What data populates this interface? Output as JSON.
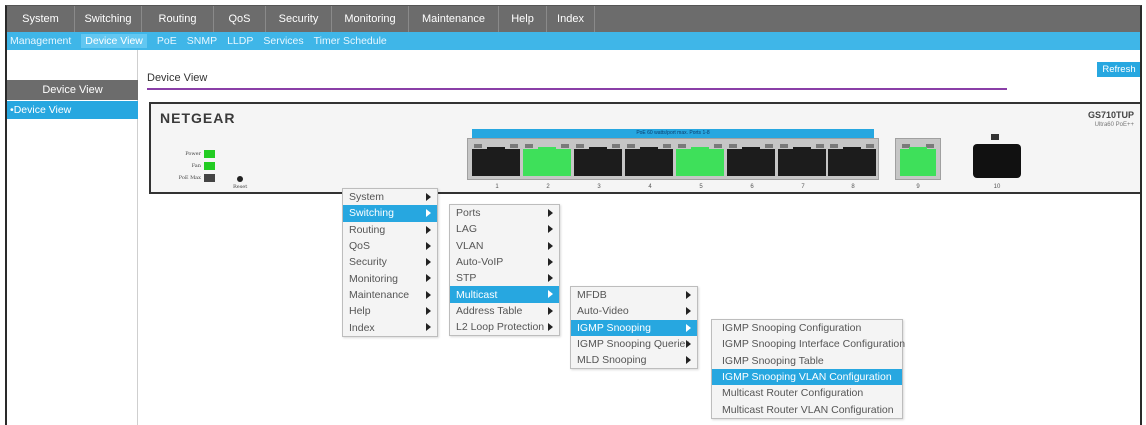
{
  "topnav": {
    "tabs": [
      {
        "label": "System",
        "active": true
      },
      {
        "label": "Switching",
        "active": false
      },
      {
        "label": "Routing",
        "active": false
      },
      {
        "label": "QoS",
        "active": false
      },
      {
        "label": "Security",
        "active": false
      },
      {
        "label": "Monitoring",
        "active": false
      },
      {
        "label": "Maintenance",
        "active": false
      },
      {
        "label": "Help",
        "active": false
      },
      {
        "label": "Index",
        "active": false
      }
    ]
  },
  "subnav": {
    "items": [
      {
        "label": "Management",
        "active": false
      },
      {
        "label": "Device View",
        "active": true
      },
      {
        "label": "PoE",
        "active": false
      },
      {
        "label": "SNMP",
        "active": false
      },
      {
        "label": "LLDP",
        "active": false
      },
      {
        "label": "Services",
        "active": false
      },
      {
        "label": "Timer Schedule",
        "active": false
      }
    ]
  },
  "left_panel": {
    "heading": "Device View",
    "items": [
      {
        "label": "Device View",
        "active": true
      }
    ]
  },
  "content": {
    "title": "Device View",
    "refresh_label": "Refresh"
  },
  "device": {
    "brand": "NETGEAR",
    "model": "GS710TUP",
    "model_sub": "Ultra60 PoE++",
    "leds": [
      {
        "label": "Power",
        "color": "#22cc22"
      },
      {
        "label": "Fan",
        "color": "#22cc22"
      },
      {
        "label": "PoE Max",
        "color": "#444444"
      }
    ],
    "reset_label": "Reset",
    "poe_banner": "PoE 60 watts/port max. Ports 1-8",
    "ports": [
      {
        "number": "1",
        "state": "inactive"
      },
      {
        "number": "2",
        "state": "active"
      },
      {
        "number": "3",
        "state": "inactive"
      },
      {
        "number": "4",
        "state": "inactive"
      },
      {
        "number": "5",
        "state": "active"
      },
      {
        "number": "6",
        "state": "inactive"
      },
      {
        "number": "7",
        "state": "inactive"
      },
      {
        "number": "8",
        "state": "inactive"
      }
    ],
    "port9": {
      "number": "9",
      "state": "active"
    },
    "port10": {
      "number": "10",
      "state": "sfp"
    }
  },
  "menus": {
    "level1": [
      {
        "label": "System",
        "selected": false
      },
      {
        "label": "Switching",
        "selected": true
      },
      {
        "label": "Routing",
        "selected": false
      },
      {
        "label": "QoS",
        "selected": false
      },
      {
        "label": "Security",
        "selected": false
      },
      {
        "label": "Monitoring",
        "selected": false
      },
      {
        "label": "Maintenance",
        "selected": false
      },
      {
        "label": "Help",
        "selected": false
      },
      {
        "label": "Index",
        "selected": false
      }
    ],
    "level2": [
      {
        "label": "Ports",
        "selected": false
      },
      {
        "label": "LAG",
        "selected": false
      },
      {
        "label": "VLAN",
        "selected": false
      },
      {
        "label": "Auto-VoIP",
        "selected": false
      },
      {
        "label": "STP",
        "selected": false
      },
      {
        "label": "Multicast",
        "selected": true
      },
      {
        "label": "Address Table",
        "selected": false
      },
      {
        "label": "L2 Loop Protection",
        "selected": false
      }
    ],
    "level3": [
      {
        "label": "MFDB",
        "selected": false
      },
      {
        "label": "Auto-Video",
        "selected": false
      },
      {
        "label": "IGMP Snooping",
        "selected": true
      },
      {
        "label": "IGMP Snooping Querier",
        "selected": false
      },
      {
        "label": "MLD Snooping",
        "selected": false
      }
    ],
    "level4": [
      {
        "label": "IGMP Snooping Configuration",
        "selected": false
      },
      {
        "label": "IGMP Snooping Interface Configuration",
        "selected": false
      },
      {
        "label": "IGMP Snooping Table",
        "selected": false
      },
      {
        "label": "IGMP Snooping VLAN Configuration",
        "selected": true
      },
      {
        "label": "Multicast Router Configuration",
        "selected": false
      },
      {
        "label": "Multicast Router VLAN Configuration",
        "selected": false
      }
    ]
  },
  "colors": {
    "accent": "#27a7e0",
    "nav_gray": "#6c6c6c",
    "port_active": "#3ee05a",
    "port_inactive": "#1c1c1c",
    "title_rule": "#8a3fa7"
  }
}
